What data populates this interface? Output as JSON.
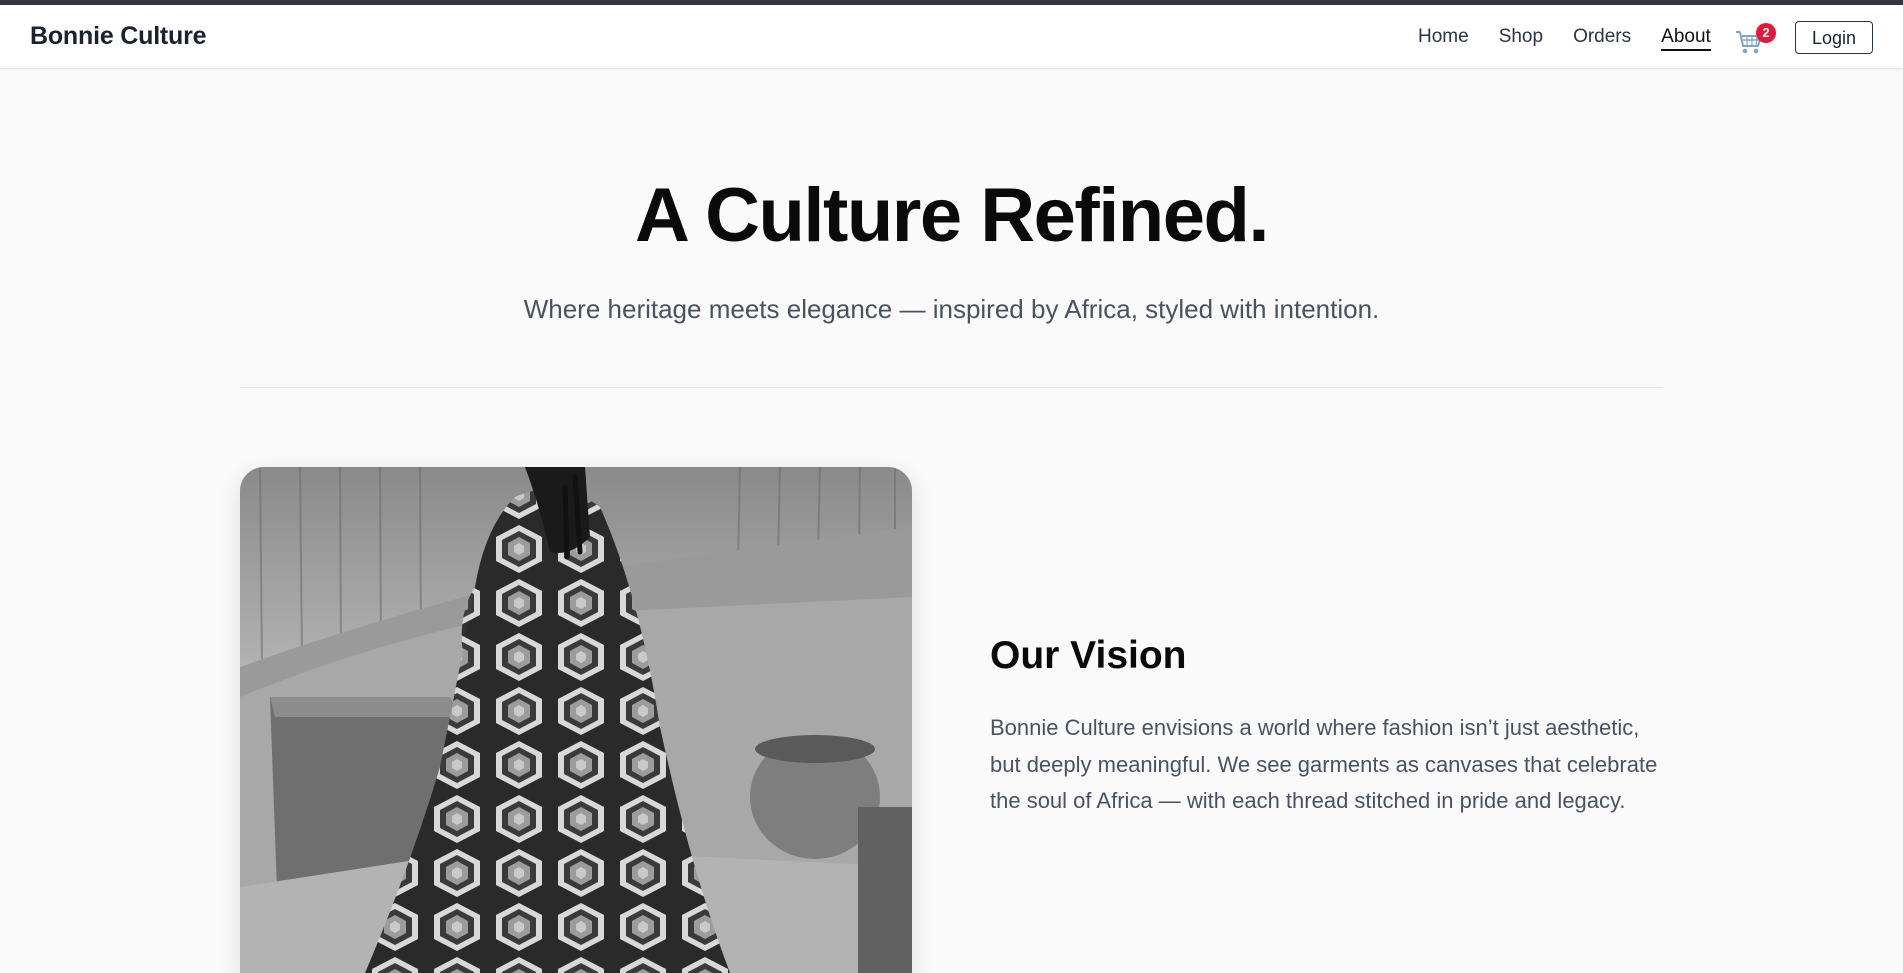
{
  "navbar": {
    "brand": "Bonnie Culture",
    "links": [
      {
        "label": "Home",
        "active": false
      },
      {
        "label": "Shop",
        "active": false
      },
      {
        "label": "Orders",
        "active": false
      },
      {
        "label": "About",
        "active": true
      }
    ],
    "cart": {
      "icon": "cart-icon",
      "count": "2"
    },
    "login_label": "Login"
  },
  "hero": {
    "title": "A Culture Refined.",
    "subtitle": "Where heritage meets elegance — inspired by Africa, styled with intention."
  },
  "vision": {
    "image_icon": "woman-in-african-print-dress-photo",
    "title": "Our Vision",
    "body": "Bonnie Culture envisions a world where fashion isn’t just aesthetic, but deeply meaningful. We see garments as canvases that celebrate the soul of Africa — with each thread stitched in pride and legacy."
  },
  "colors": {
    "accent_strip": "#3a3342",
    "badge": "#e5173a",
    "page_background": "#fafafa",
    "text_muted": "#4a5262"
  }
}
